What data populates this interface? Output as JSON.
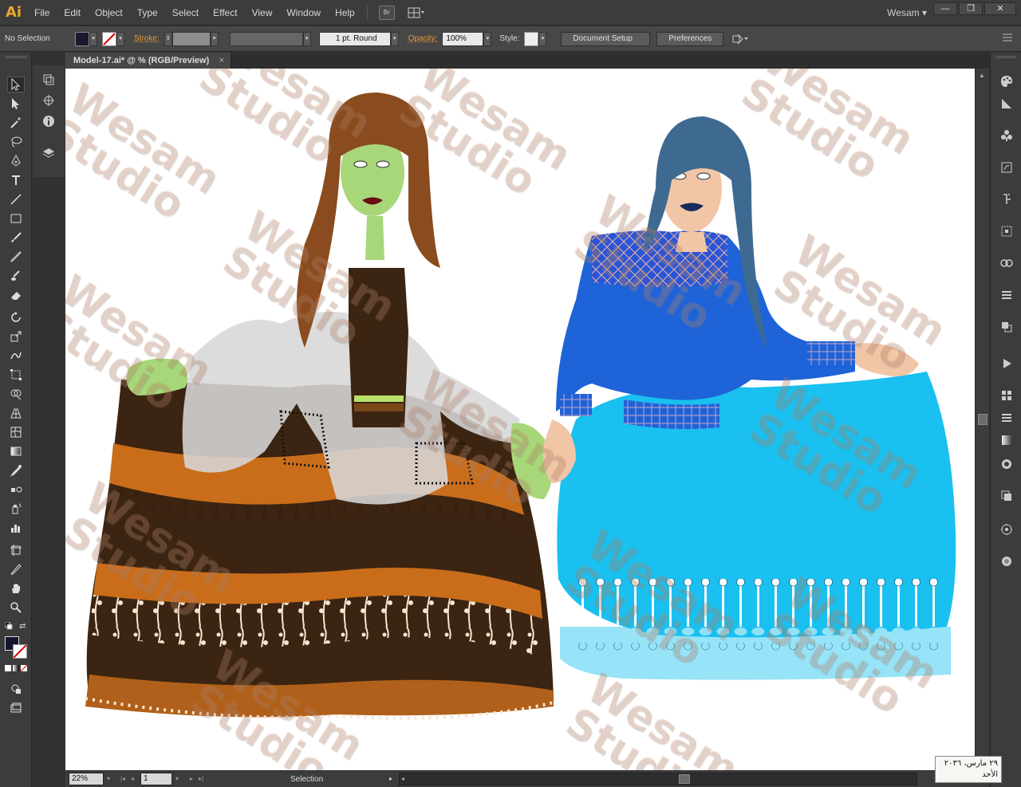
{
  "app": {
    "logo": "Ai",
    "menus": [
      "File",
      "Edit",
      "Object",
      "Type",
      "Select",
      "Effect",
      "View",
      "Window",
      "Help"
    ],
    "bridge_label": "Br",
    "workspace": "Wesam",
    "window_controls": {
      "minimize": "—",
      "restore": "❐",
      "close": "✕"
    }
  },
  "control_bar": {
    "selection_label": "No Selection",
    "stroke_label": "Stroke:",
    "stroke_profile": "1 pt. Round",
    "opacity_label": "Opacity:",
    "opacity_value": "100%",
    "style_label": "Style:",
    "document_setup_label": "Document Setup",
    "preferences_label": "Preferences"
  },
  "document": {
    "tab_title": "Model-17.ai* @ % (RGB/Preview)",
    "close_glyph": "×"
  },
  "watermark": {
    "text_line1": "Wesam",
    "text_line2": "Studio"
  },
  "status_bar": {
    "zoom": "22%",
    "artboard": "1",
    "tool_status": "Selection"
  },
  "taskbar_clock": {
    "date_line": "٢٩ مارس، ٢٠٣٦",
    "day_line": "الأحد"
  },
  "colors": {
    "accent_orange": "#e8a82d",
    "chrome_dark": "#323232",
    "canvas": "#ffffff"
  },
  "icons": {
    "left_tools": [
      "selection-tool-icon",
      "direct-selection-tool-icon",
      "magic-wand-icon",
      "lasso-icon",
      "pen-tool-icon",
      "type-tool-icon",
      "line-tool-icon",
      "rectangle-tool-icon",
      "paintbrush-icon",
      "pencil-icon",
      "blob-brush-icon",
      "eraser-icon",
      "rotate-tool-icon",
      "scale-tool-icon",
      "warp-tool-icon",
      "free-transform-icon",
      "shape-builder-icon",
      "perspective-grid-icon",
      "mesh-tool-icon",
      "gradient-tool-icon",
      "eyedropper-icon",
      "blend-tool-icon",
      "symbol-sprayer-icon",
      "column-graph-icon",
      "artboard-tool-icon",
      "slice-tool-icon",
      "hand-tool-icon",
      "zoom-tool-icon"
    ],
    "right_panels": [
      "color-panel-icon",
      "color-guide-icon",
      "swatches-icon",
      "brushes-icon",
      "symbols-icon",
      "stroke-icon",
      "gradient-icon",
      "transparency-icon",
      "appearance-icon",
      "graphic-styles-icon",
      "layers-icon",
      "artboards-icon",
      "links-icon",
      "align-icon",
      "transform-icon",
      "pathfinder-icon"
    ]
  }
}
